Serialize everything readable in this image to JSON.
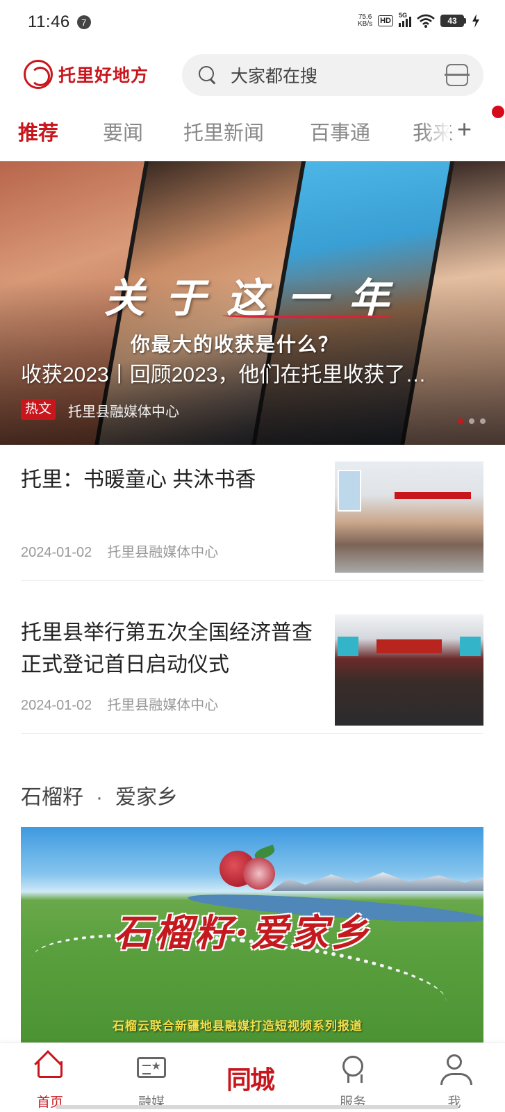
{
  "status_bar": {
    "time": "11:46",
    "notification_count": "7",
    "net_speed_value": "75.6",
    "net_speed_unit": "KB/s",
    "hd_label": "HD",
    "signal_label": "5G",
    "battery_level": "43"
  },
  "header": {
    "logo_text": "托里好地方",
    "search_placeholder": "大家都在搜"
  },
  "tabs": [
    {
      "label": "推荐",
      "active": true
    },
    {
      "label": "要闻",
      "active": false
    },
    {
      "label": "托里新闻",
      "active": false
    },
    {
      "label": "百事通",
      "active": false
    },
    {
      "label": "我来",
      "active": false
    }
  ],
  "hero": {
    "calligraphy": "关于这一年",
    "question": "你最大的收获是什么？",
    "title": "收获2023丨回顾2023，他们在托里收获了…",
    "tag": "热文",
    "source": "托里县融媒体中心",
    "slide_count": 3,
    "active_slide": 1
  },
  "news": [
    {
      "title": "托里：书暖童心 共沐书香",
      "date": "2024-01-02",
      "source": "托里县融媒体中心"
    },
    {
      "title": "托里县举行第五次全国经济普查正式登记首日启动仪式",
      "date": "2024-01-02",
      "source": "托里县融媒体中心"
    }
  ],
  "section": {
    "title_left": "石榴籽",
    "separator": "·",
    "title_right": "爱家乡",
    "promo_title": "石榴籽·爱家乡",
    "promo_caption": "石榴云联合新疆地县融媒打造短视频系列报道"
  },
  "bottom_nav": {
    "home": "首页",
    "media": "融媒",
    "city": "同城",
    "service": "服务",
    "me": "我"
  },
  "colors": {
    "accent": "#c8161d",
    "inactive": "#888888"
  },
  "icons": [
    "search-icon",
    "scan-icon",
    "add-tab-icon",
    "home-icon",
    "media-icon",
    "service-icon",
    "profile-icon"
  ]
}
